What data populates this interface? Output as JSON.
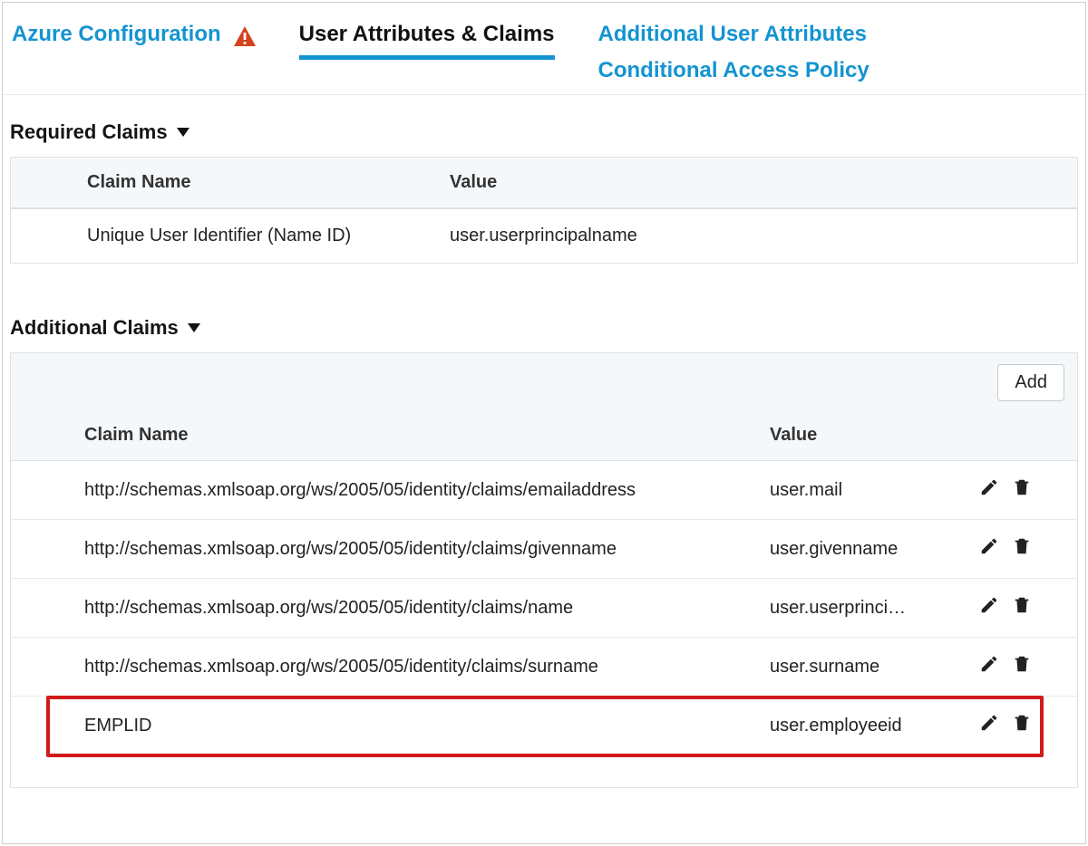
{
  "tabs": {
    "azure": "Azure Configuration",
    "claims": "User Attributes & Claims",
    "additional": "Additional User Attributes",
    "policy": "Conditional Access Policy"
  },
  "required": {
    "title": "Required Claims",
    "headers": {
      "name": "Claim Name",
      "value": "Value"
    },
    "rows": [
      {
        "name": "Unique User Identifier (Name ID)",
        "value": "user.userprincipalname"
      }
    ]
  },
  "additional_claims": {
    "title": "Additional Claims",
    "add_label": "Add",
    "headers": {
      "name": "Claim Name",
      "value": "Value"
    },
    "rows": [
      {
        "name": "http://schemas.xmlsoap.org/ws/2005/05/identity/claims/emailaddress",
        "value": "user.mail"
      },
      {
        "name": "http://schemas.xmlsoap.org/ws/2005/05/identity/claims/givenname",
        "value": "user.givenname"
      },
      {
        "name": "http://schemas.xmlsoap.org/ws/2005/05/identity/claims/name",
        "value": "user.userprinci…"
      },
      {
        "name": "http://schemas.xmlsoap.org/ws/2005/05/identity/claims/surname",
        "value": "user.surname"
      },
      {
        "name": "EMPLID",
        "value": "user.employeeid"
      }
    ]
  }
}
